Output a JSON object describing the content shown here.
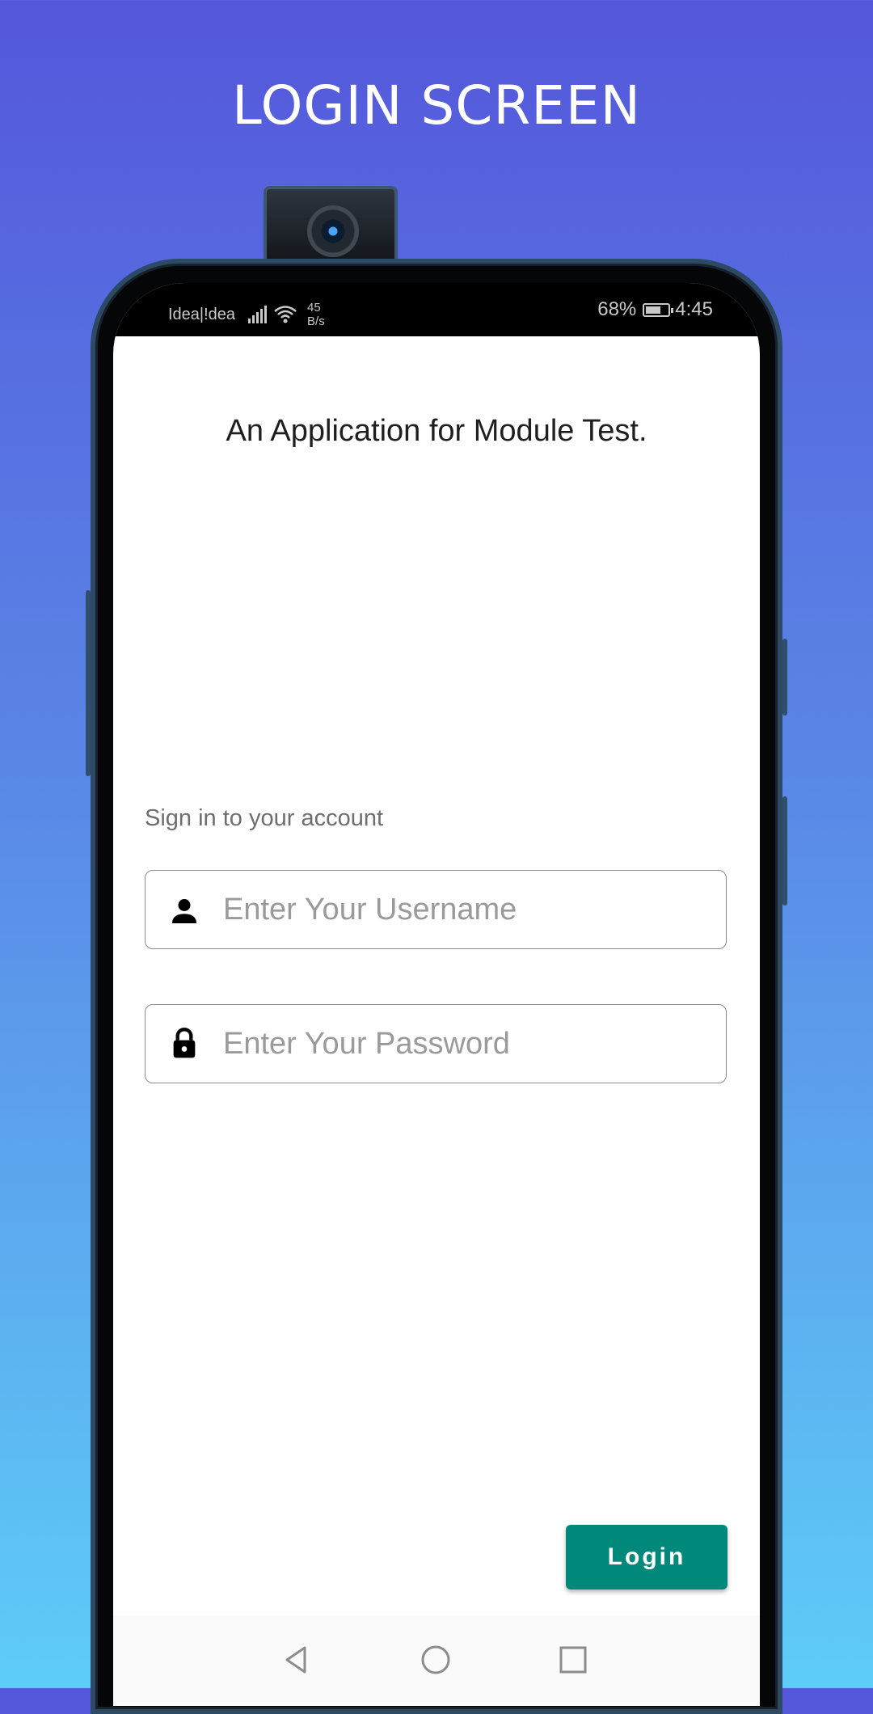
{
  "page_title": "LOGIN SCREEN",
  "status_bar": {
    "carrier": "Idea|!dea",
    "speed_value": "45",
    "speed_unit": "B/s",
    "battery": "68%",
    "time": "4:45"
  },
  "app": {
    "subtitle": "An Application for Module Test.",
    "signin_label": "Sign in to your account",
    "username_placeholder": "Enter Your Username",
    "password_placeholder": "Enter Your Password",
    "login_label": "Login"
  },
  "colors": {
    "accent": "#00897b",
    "bg_top": "#5457db",
    "bg_bottom": "#5ecdf8"
  },
  "icons": [
    "person-icon",
    "lock-icon",
    "signal-icon",
    "wifi-icon",
    "battery-icon",
    "back-icon",
    "home-icon",
    "recents-icon"
  ]
}
